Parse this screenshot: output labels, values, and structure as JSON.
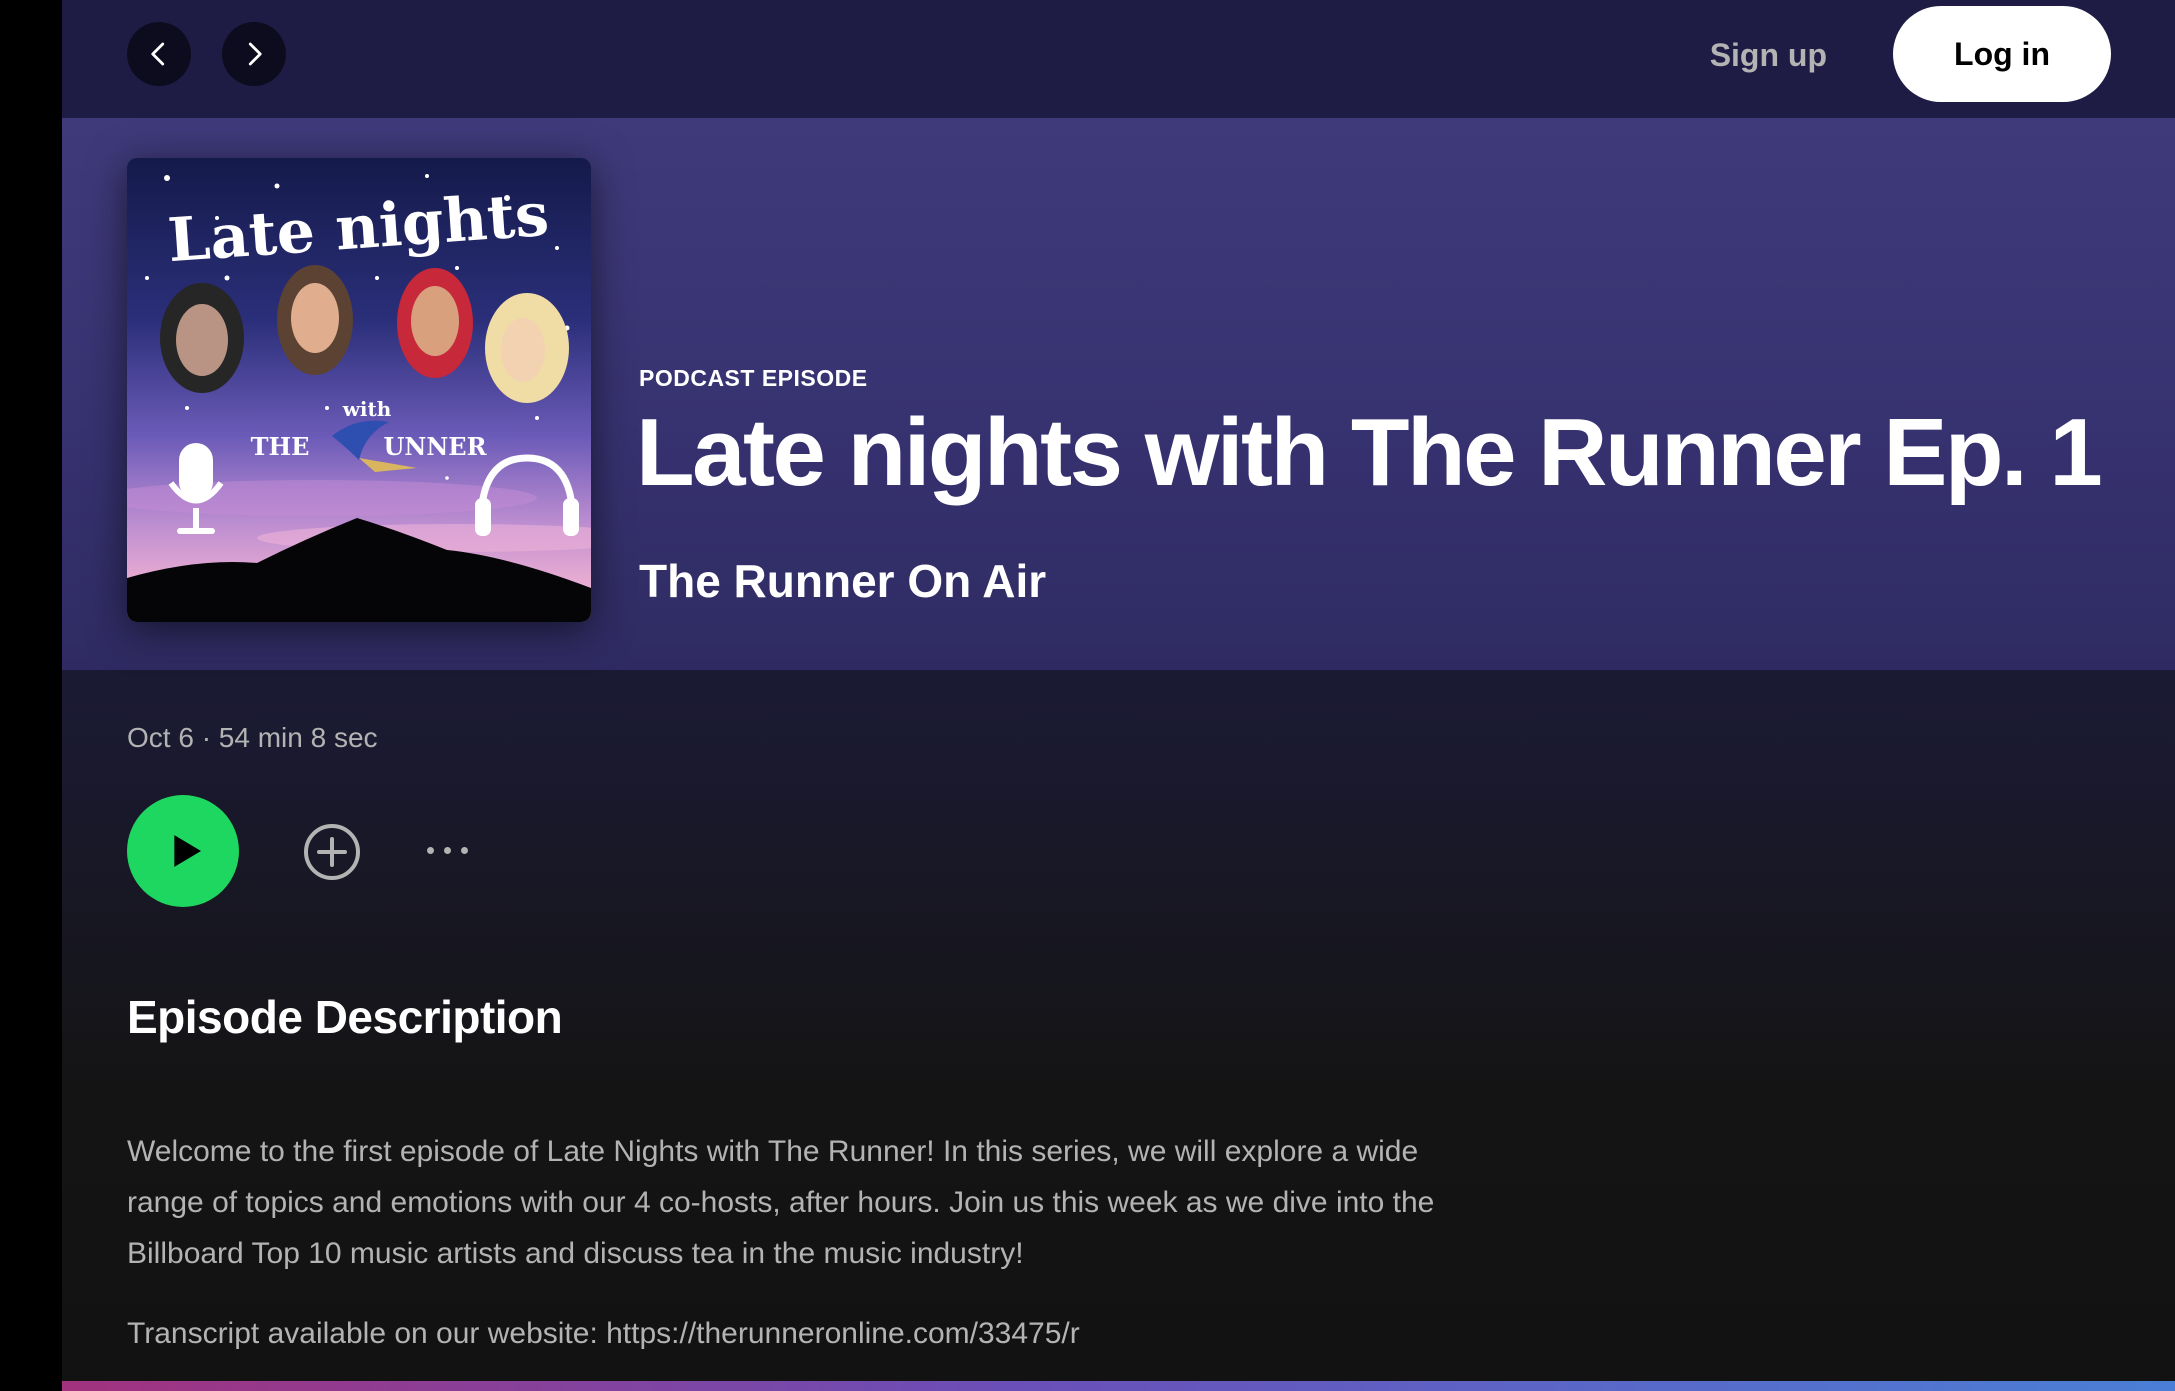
{
  "nav": {
    "sign_up": "Sign up",
    "log_in": "Log in"
  },
  "episode": {
    "kind": "PODCAST EPISODE",
    "title": "Late nights with The Runner Ep. 1",
    "show": "The Runner On Air",
    "meta": "Oct 6 · 54 min 8 sec"
  },
  "cover": {
    "title": "Late nights",
    "with": "with",
    "the": "THE",
    "runner": "UNNER"
  },
  "description": {
    "heading": "Episode Description",
    "body": "Welcome to the first episode of Late Nights with The Runner! In this series, we will explore a wide range of topics and emotions with our 4 co-hosts, after hours. Join us this week as we dive into the Billboard Top 10 music artists and discuss tea in the music industry!",
    "transcript": "Transcript available on our website: https://therunneronline.com/33475/r"
  },
  "colors": {
    "accent_green": "#1ed760",
    "hero": "#3f3a7a",
    "topbar": "#1e1c44"
  },
  "icons": [
    "chevron-left-icon",
    "chevron-right-icon",
    "play-icon",
    "add-circle-icon",
    "more-icon"
  ]
}
